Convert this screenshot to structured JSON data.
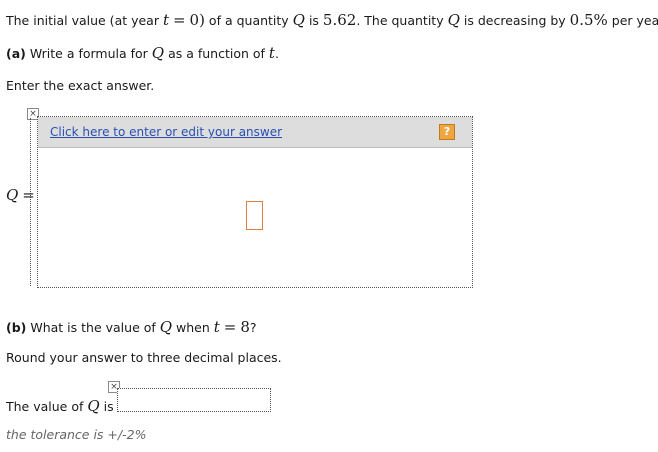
{
  "intro": {
    "t1": "The initial value (at year ",
    "t_var": "t",
    "eq": "=",
    "zero_paren": "0)",
    "t2": " of a quantity ",
    "q_var": "Q",
    "t3": " is ",
    "value": "5.62",
    "t4": ". The quantity ",
    "q_var2": "Q",
    "t5": " is decreasing by ",
    "rate": "0.5%",
    "t6": " per year."
  },
  "part_a": {
    "label": "(a)",
    "t1": " Write a formula for ",
    "q_var": "Q",
    "t2": " as a function of ",
    "t_var": "t",
    "t3": "."
  },
  "instruction_a": "Enter the exact answer.",
  "editor": {
    "link_label": "Click here to enter or edit your answer",
    "help_label": "?",
    "close_glyph": "×"
  },
  "q_equals": {
    "q": "Q",
    "eq": "="
  },
  "part_b": {
    "label": "(b)",
    "t1": " What is the value of ",
    "q_var": "Q",
    "t2": " when ",
    "t_var": "t",
    "eq": "=",
    "eight": "8",
    "t3": "?"
  },
  "instruction_b": "Round your answer to three decimal places.",
  "answer_b": {
    "t1": "The value of ",
    "q_var": "Q",
    "t2": " is",
    "close_glyph": "×",
    "value": ""
  },
  "tolerance": "the tolerance is +/-2%"
}
